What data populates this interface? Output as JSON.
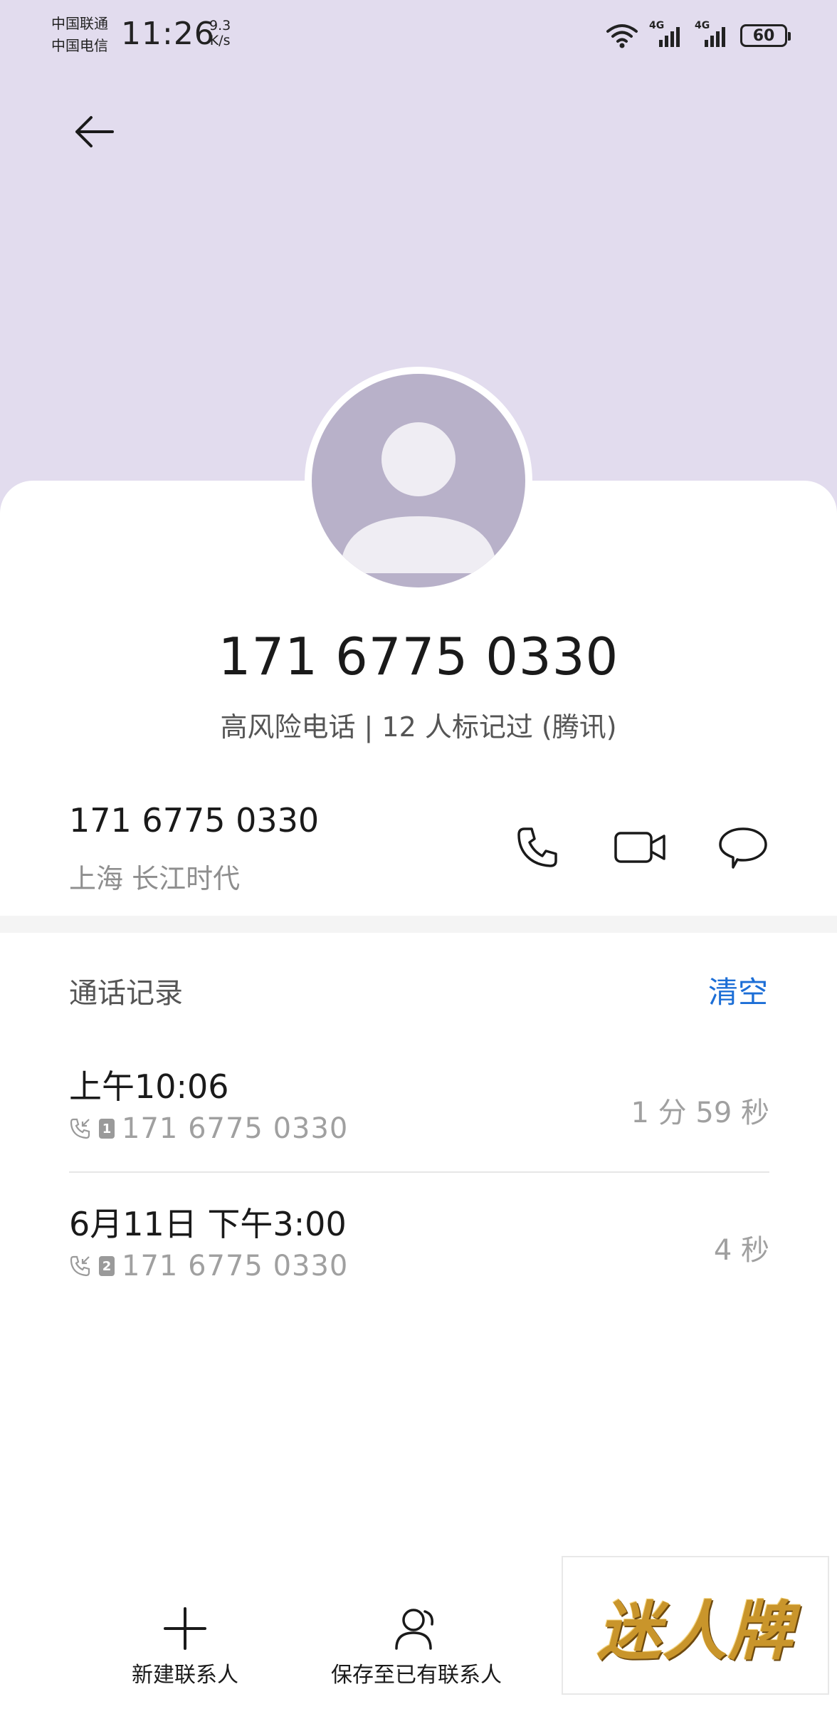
{
  "status_bar": {
    "carrier_1": "中国联通",
    "carrier_2": "中国电信",
    "time": "11:26",
    "net_speed_value": "9.3",
    "net_speed_unit": "K/s",
    "signal_1_label": "4G",
    "signal_2_label": "4G",
    "battery_level": "60"
  },
  "contact": {
    "number": "171 6775 0330",
    "risk_label": "高风险电话 | 12 人标记过 (腾讯)",
    "detail_number": "171 6775 0330",
    "location": "上海 长江时代"
  },
  "call_history": {
    "title": "通话记录",
    "clear_label": "清空",
    "records": [
      {
        "time": "上午10:06",
        "sim": "1",
        "number": "171 6775 0330",
        "duration": "1 分 59 秒"
      },
      {
        "time": "6月11日 下午3:00",
        "sim": "2",
        "number": "171 6775 0330",
        "duration": "4 秒"
      }
    ]
  },
  "bottom_bar": {
    "new_contact_label": "新建联系人",
    "save_existing_label": "保存至已有联系人"
  },
  "watermark": {
    "text": "迷人牌"
  },
  "colors": {
    "header_bg": "#e2dcee",
    "avatar_bg": "#b8b1c9",
    "accent": "#1c6ed6"
  }
}
